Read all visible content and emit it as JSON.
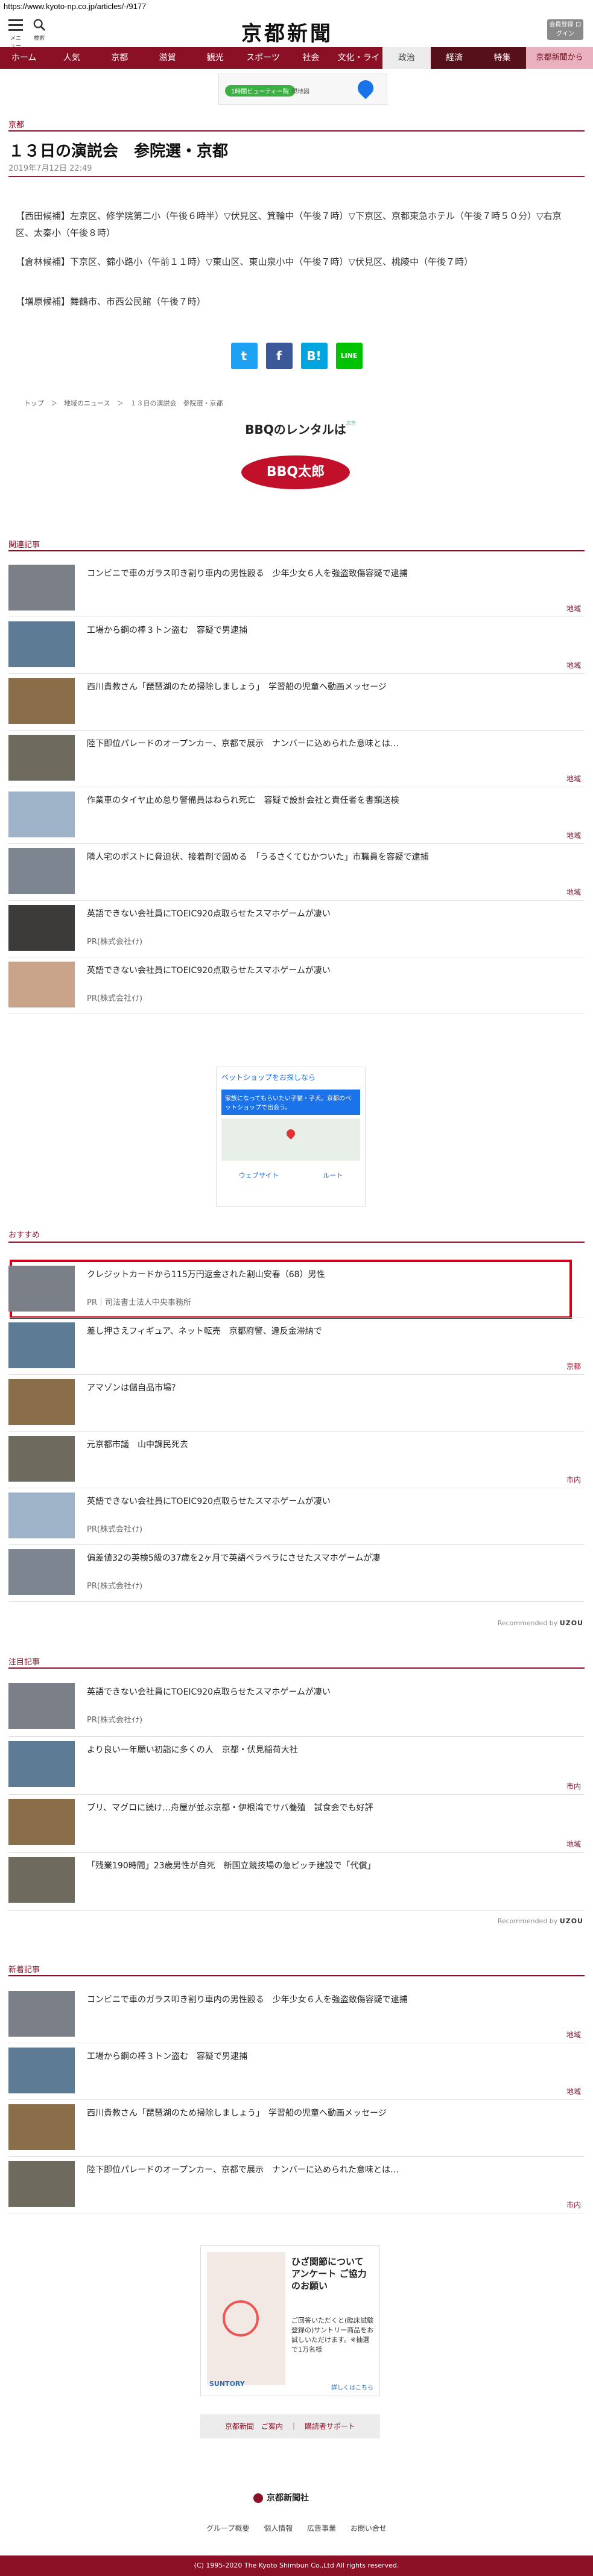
{
  "browser": {
    "url": "https://www.kyoto-np.co.jp/articles/-/9177"
  },
  "header": {
    "menu_label": "メニュー",
    "search_label": "検索",
    "logo": "京都新聞",
    "login_label": "会員登録 ログイン"
  },
  "nav": [
    "ホーム",
    "人気",
    "京都",
    "滋賀",
    "観光",
    "スポーツ",
    "社会",
    "文化・ライフ",
    "政治",
    "経済",
    "特集",
    "京都新聞から"
  ],
  "top_ad": {
    "pill": "1時間ビューティー院",
    "text": "現地図"
  },
  "article": {
    "section": "京都",
    "title": "１３日の演説会　参院選・京都",
    "date": "2019年7月12日 22:49",
    "paragraphs": [
      "【西田候補】左京区、修学院第二小（午後６時半）▽伏見区、箕輪中（午後７時）▽下京区、京都東急ホテル（午後７時５０分）▽右京区、太秦小（午後８時）",
      "【倉林候補】下京区、錦小路小（午前１１時）▽東山区、東山泉小中（午後７時）▽伏見区、桃陵中（午後７時）",
      "【増原候補】舞鶴市、市西公民館（午後７時）"
    ]
  },
  "share": [
    "t",
    "f",
    "B!",
    "LINE"
  ],
  "breadcrumb": "トップ　＞　地域のニュース　＞　１３日の演説会　参院選・京都",
  "bbq_ad": {
    "title": "BBQのレンタルは",
    "badge": "広告",
    "logo": "BBQ太郎"
  },
  "sections": {
    "related": "関連記事",
    "recommend": "おすすめ",
    "attention": "注目記事",
    "latest": "新着記事"
  },
  "related": [
    {
      "title": "コンビニで車のガラス叩き割り車内の男性殴る　少年少女６人を強盗致傷容疑で逮捕",
      "cat": "地域"
    },
    {
      "title": "工場から鋼の棒３トン盗む　容疑で男逮捕",
      "cat": "地域"
    },
    {
      "title": "西川貴教さん「琵琶湖のため掃除しましょう」　学習船の児童へ動画メッセージ",
      "cat": ""
    },
    {
      "title": "陸下即位パレードのオープンカー、京都で展示　ナンバーに込められた意味とは…",
      "cat": "地域"
    },
    {
      "title": "作業車のタイヤ止め怠り警備員はねられ死亡　容疑で設計会社と責任者を書類送検",
      "cat": "地域"
    },
    {
      "title": "隣人宅のポストに脅迫状、接着剤で固める　「うるさくてむかついた」市職員を容疑で逮捕",
      "cat": "地域"
    },
    {
      "title": "英語できない会社員にTOEIC920点取らせたスマホゲームが凄い",
      "pr": "PR(株式会社ｲﾅ)"
    },
    {
      "title": "英語できない会社員にTOEIC920点取らせたスマホゲームが凄い",
      "pr": "PR(株式会社ｲﾅ)"
    }
  ],
  "mid_ad": {
    "headline": "ペットショップをお探しなら",
    "card": "家族になってもらいたい子猫・子犬。京都のペットショップで出会う。",
    "btn_left": "ウェブサイト",
    "btn_right": "ルート"
  },
  "recommend": [
    {
      "title": "クレジットカードから115万円返金された割山安春（68）男性",
      "pr": "PR｜司法書士法人中央事務所"
    },
    {
      "title": "差し押さえフィギュア、ネット転売　京都府警、違反金滞納で",
      "cat": "京都"
    },
    {
      "title": "アマゾンは儲自品市場？",
      "cat": ""
    },
    {
      "title": "元京都市議　山中課民死去",
      "cat": "市内"
    },
    {
      "title": "英語できない会社員にTOEIC920点取らせたスマホゲームが凄い",
      "pr": "PR(株式会社ｲﾅ)"
    },
    {
      "title": "偏差値32の英検5級の37歳を2ヶ月で英語ペラペラにさせたスマホゲームが凄",
      "pr": "PR(株式会社ｲﾅ)"
    }
  ],
  "recommended_by": "Recommended by",
  "recommended_brand": "UZOU",
  "attention": [
    {
      "title": "英語できない会社員にTOEIC920点取らせたスマホゲームが凄い",
      "pr": "PR(株式会社ｲﾅ)"
    },
    {
      "title": "より良い一年願い初詣に多くの人　京都・伏見稲荷大社",
      "cat": "市内"
    },
    {
      "title": "ブリ、マグロに続け…舟屋が並ぶ京都・伊根湾でサバ養殖　試食会でも好評",
      "cat": "地域"
    },
    {
      "title": "「残業190時間」23歳男性が自死　新国立競技場の急ピッチ建設で「代償」",
      "cat": ""
    }
  ],
  "latest": [
    {
      "title": "コンビニで車のガラス叩き割り車内の男性殴る　少年少女６人を強盗致傷容疑で逮捕",
      "cat": "地域"
    },
    {
      "title": "工場から鋼の棒３トン盗む　容疑で男逮捕",
      "cat": "地域"
    },
    {
      "title": "西川貴教さん「琵琶湖のため掃除しましょう」　学習船の児童へ動画メッセージ",
      "cat": ""
    },
    {
      "title": "陸下即位パレードのオープンカー、京都で展示　ナンバーに込められた意味とは…",
      "cat": "市内"
    }
  ],
  "bottom_ad": {
    "copy": "ひざ関節について アンケート ご協力のお願い",
    "sub": "ご回答いただくと(臨床試験登録の)サントリー商品をお試しいただけます。※抽選で1万名様",
    "brand": "SUNTORY",
    "more": "詳しくはこちら"
  },
  "subscribe": "京都新聞　ご案内　｜　購読者サポート",
  "footer": {
    "logo": "京都新聞社",
    "links": [
      "グループ概要",
      "個人情報",
      "広告事業",
      "お問い合せ"
    ],
    "copyright": "(C) 1995-2020 The Kyoto Shimbun Co.,Ltd All rights reserved."
  },
  "colors": {
    "brand": "#8b1026",
    "highlight": "#d4001a"
  }
}
